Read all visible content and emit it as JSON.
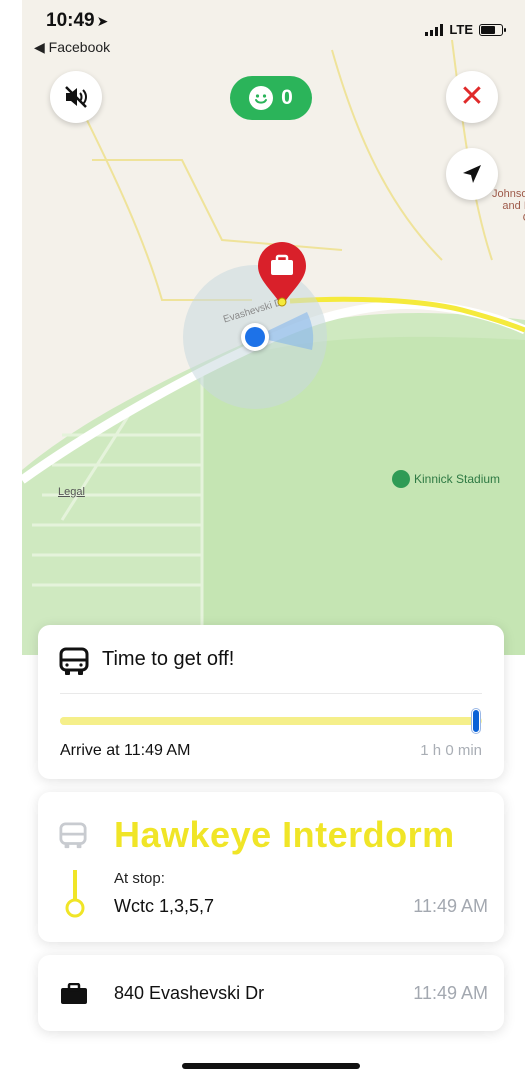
{
  "status_bar": {
    "time": "10:49",
    "back_app": "Facebook",
    "network": "LTE"
  },
  "map": {
    "rider_count": "0",
    "legal_label": "Legal",
    "clinic_label": "ersi\n We\nJohnson S\nand Hea\nClini",
    "stadium_label": "Kinnick Stadium",
    "street_label": "Evashevski Dr",
    "icons": {
      "mute": "speaker-muted-icon",
      "close": "close-icon",
      "locate": "location-arrow-icon",
      "destination_pin": "briefcase-pin-icon",
      "user_location": "blue-dot-icon"
    }
  },
  "trip_card": {
    "title": "Time to get off!",
    "arrive_label": "Arrive at 11:49 AM",
    "duration": "1 h 0 min",
    "progress": 0.99
  },
  "route_card": {
    "route_name": "Hawkeye Interdorm",
    "at_stop_label": "At stop:",
    "stop_name": "Wctc 1,3,5,7",
    "stop_time": "11:49 AM"
  },
  "destination_card": {
    "address": "840 Evashevski Dr",
    "time": "11:49 AM"
  },
  "colors": {
    "accent_yellow": "#f0e527",
    "green": "#2bb45a",
    "blue_dot": "#1d72e8",
    "pin_red": "#d9202a"
  }
}
